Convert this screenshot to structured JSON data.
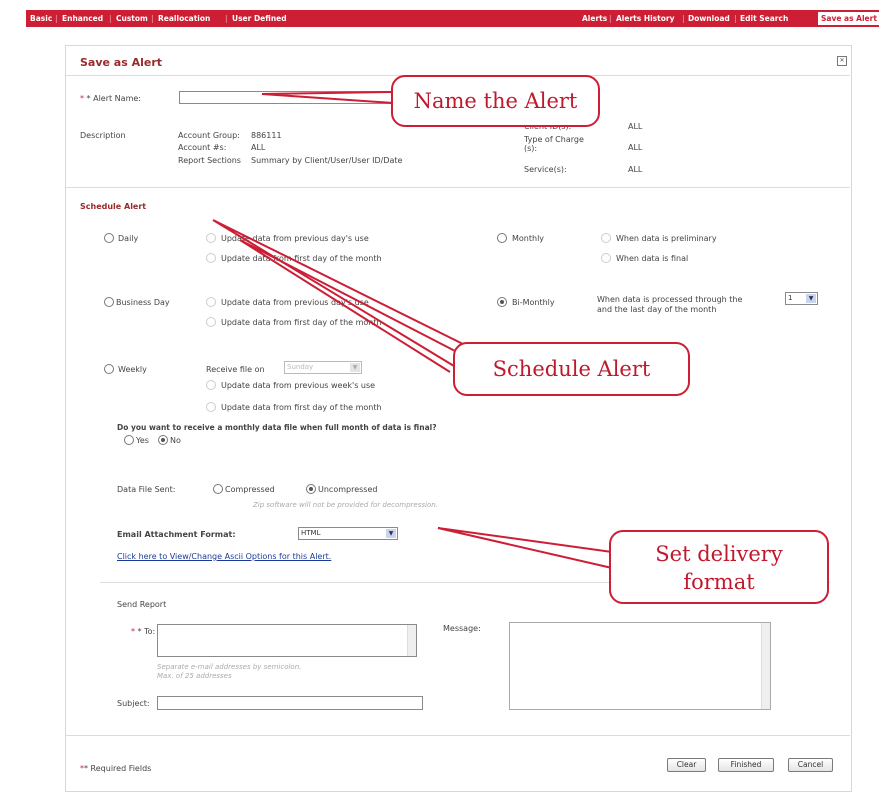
{
  "nav": {
    "left": [
      "Basic",
      "Enhanced",
      "Custom",
      "Reallocation",
      "User Defined"
    ],
    "right": [
      "Alerts",
      "Alerts History",
      "Download",
      "Edit Search"
    ],
    "active": "Save as Alert"
  },
  "dialog": {
    "title": "Save as Alert",
    "close_glyph": "✕",
    "alert_name_label": "* Alert Name:",
    "alert_name_value": "",
    "description": {
      "label": "Description",
      "account_group_label": "Account Group:",
      "account_group_value": "886111",
      "account_label": "Account #s:",
      "account_value": "ALL",
      "report_sections_label": "Report Sections",
      "report_sections_value": "Summary by Client/User/User ID/Date",
      "client_ids_label": "Client ID(s):",
      "client_ids_value": "ALL",
      "type_of_charge_label": "Type of Charge (s):",
      "type_of_charge_value": "ALL",
      "services_label": "Service(s):",
      "services_value": "ALL"
    },
    "schedule": {
      "title": "Schedule Alert",
      "daily": "Daily",
      "daily_opt1": "Update data from previous day's use",
      "daily_opt2": "Update data from first day of the month",
      "monthly": "Monthly",
      "monthly_opt1": "When data is preliminary",
      "monthly_opt2": "When data is final",
      "business_day": "Business Day",
      "bd_opt1": "Update data from previous day's use",
      "bd_opt2": "Update data from first day of the month",
      "bi_monthly": "Bi-Monthly",
      "bi_monthly_text1": "When data is processed through the",
      "bi_monthly_text2": "and the last day of the month",
      "bi_monthly_day": "1",
      "weekly": "Weekly",
      "receive_file_on": "Receive file on",
      "weekday": "Sunday",
      "weekly_opt1": "Update data from previous week's use",
      "weekly_opt2": "Update data from first day of the month",
      "monthly_question": "Do you want to receive a monthly data file when full month of data is final?",
      "yes": "Yes",
      "no": "No"
    },
    "data_file": {
      "label": "Data File Sent:",
      "compressed": "Compressed",
      "uncompressed": "Uncompressed",
      "note": "Zip software will not be provided for decompression."
    },
    "email_format": {
      "label": "Email Attachment Format:",
      "value": "HTML",
      "link": "Click here to View/Change Ascii Options for this Alert."
    },
    "send_report": {
      "title": "Send Report",
      "to_label": "* To:",
      "to_value": "",
      "hint1": "Separate e-mail addresses by semicolon.",
      "hint2": "Max. of 25 addresses",
      "message_label": "Message:",
      "message_value": "",
      "subject_label": "Subject:",
      "subject_value": ""
    },
    "footer": {
      "required": "* Required Fields",
      "clear": "Clear",
      "finished": "Finished",
      "cancel": "Cancel"
    }
  },
  "callouts": {
    "name": "Name the Alert",
    "schedule": "Schedule Alert",
    "delivery_line1": "Set delivery",
    "delivery_line2": "format"
  },
  "colors": {
    "accent": "#cc1e35",
    "callout_border": "#cc1e35",
    "header_text": "#9a2a2a"
  }
}
